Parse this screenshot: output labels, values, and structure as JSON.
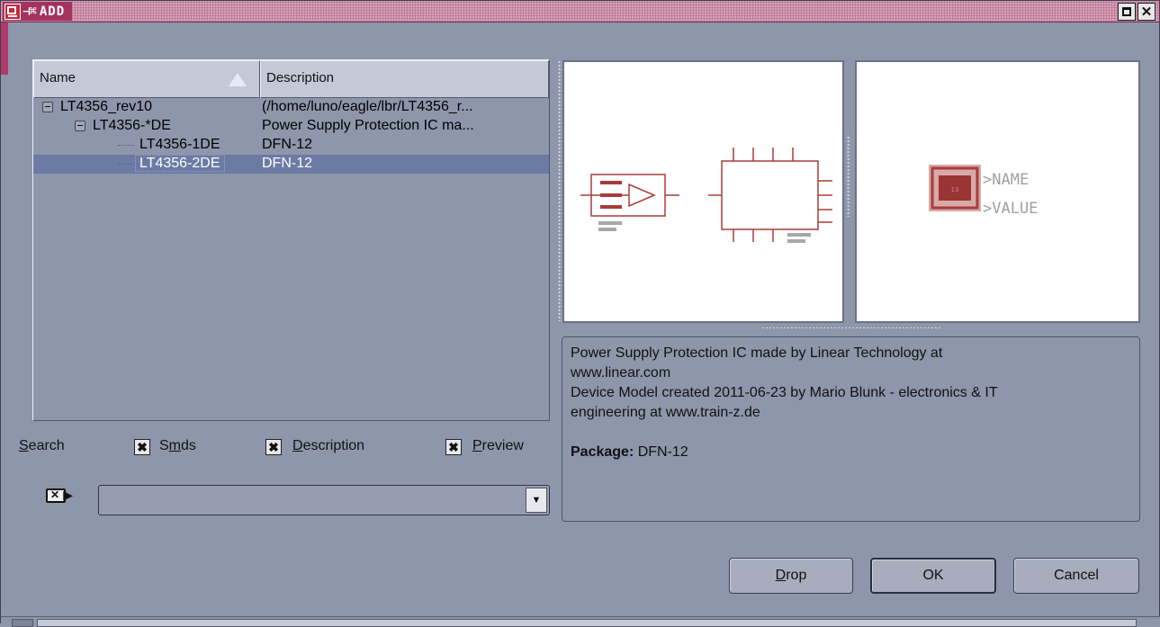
{
  "window": {
    "title": "ADD",
    "app_icon": "eagle-schematic-icon",
    "title_symbol": "⊣⌘",
    "controls": [
      "maximize",
      "close"
    ]
  },
  "tree": {
    "columns": {
      "name": "Name",
      "description": "Description"
    },
    "sort_icon": "sort-ascending-triangle-icon",
    "rows": [
      {
        "name": "LT4356_rev10",
        "description": "(/home/luno/eagle/lbr/LT4356_r...",
        "level": 0,
        "expanded": true
      },
      {
        "name": "LT4356-*DE",
        "description": "Power Supply Protection IC ma...",
        "level": 1,
        "expanded": true
      },
      {
        "name": "LT4356-1DE",
        "description": "DFN-12",
        "level": 2
      },
      {
        "name": "LT4356-2DE",
        "description": "DFN-12",
        "level": 2,
        "selected": true
      }
    ]
  },
  "options": {
    "search_label_first": "S",
    "search_label_rest": "earch",
    "smds_pre": "S",
    "smds_u": "m",
    "smds_post": "ds",
    "description_u": "D",
    "description_rest": "escription",
    "preview_u": "P",
    "preview_rest": "review",
    "smds_checked": true,
    "description_checked": true,
    "preview_checked": true,
    "check_glyph": "✖"
  },
  "search": {
    "value": "",
    "icon": "clear-search-icon"
  },
  "preview": {
    "package_name_label": ">NAME",
    "package_value_label": ">VALUE",
    "package_pad_label": "13"
  },
  "description": {
    "line1": "Power Supply Protection IC made by Linear Technology at",
    "line2": "www.linear.com",
    "line3": "Device Model created 2011-06-23 by Mario Blunk - electronics & IT",
    "line4": "engineering at www.train-z.de",
    "package_label": "Package:",
    "package_value": " DFN-12"
  },
  "buttons": {
    "drop_u": "D",
    "drop_rest": "rop",
    "ok": "OK",
    "cancel": "Cancel"
  },
  "colors": {
    "window_bg": "#8e96ab",
    "title_bar": "#a4335d",
    "selection": "#6b7ba4",
    "schematic_red": "#a83c3c"
  }
}
